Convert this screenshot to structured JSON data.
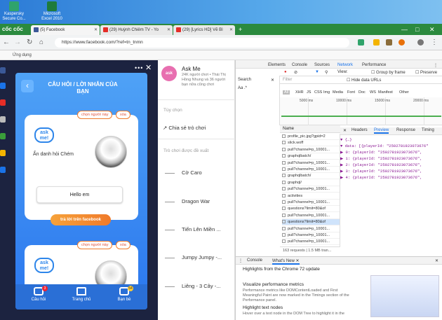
{
  "desktop": {
    "icons": [
      {
        "label": "Kaspersky Secure Co...",
        "color": "#2fa36b"
      },
      {
        "label": "Microsoft Excel 2010",
        "color": "#1e7b3b"
      }
    ]
  },
  "browser": {
    "logo": "cốc cốc",
    "tabs": [
      {
        "label": "(5) Facebook",
        "color": "#3b5998"
      },
      {
        "label": "(29) Huỳnh Chiêm TV - Yo",
        "color": "#e52d27"
      },
      {
        "label": "(29) [Lyrics HD] Vẽ Bì",
        "color": "#e52d27"
      }
    ],
    "new_tab": "+",
    "url": "https://www.facebook.com/?ref=tn_tnmn",
    "bookmarks_label": "Ứng dụng",
    "winbtns": [
      "—",
      "□",
      "✕"
    ]
  },
  "game": {
    "title": "CÂU HỎI / LỜI NHẮN CỦA BẠN",
    "back": "‹",
    "close": "✕",
    "dots": "•••",
    "cards": [
      {
        "chon": "chọn người này",
        "xoa": "xóa",
        "ask": "ask me!",
        "anon": "Ẩn danh hỏi Chém",
        "message": "Hello em",
        "reply": "trả lời trên facebook"
      },
      {
        "chon": "chọn người này",
        "xoa": "xóa",
        "ask": "ask me!"
      }
    ],
    "footer": [
      {
        "label": "Câu hỏi",
        "badge": "3"
      },
      {
        "label": "Trang chủ",
        "badge": ""
      },
      {
        "label": "Bạn bè",
        "badge": "54"
      }
    ]
  },
  "fbside": {
    "app_name": "Ask Me",
    "app_logo": "ask me!",
    "app_desc": "24K người chơi • Thái Thị Hồng Nhung và 36 người bạn nữa cũng chơi",
    "section_options": "Tùy chọn",
    "share": "Chia sẻ trò chơi",
    "section_suggested": "Trò chơi được đề xuất",
    "games": [
      "Cờ Caro",
      "Dragon War",
      "Tiến Lên Miền ...",
      "Jumpy Jumpy -...",
      "Liêng - 3 Cây -..."
    ]
  },
  "devtools": {
    "tabs": [
      "Elements",
      "Console",
      "Sources",
      "Network",
      "Performance"
    ],
    "search_label": "Search",
    "filter_label": "Filter",
    "view_label": "View:",
    "group_by_frame": "Group by frame",
    "preserve": "Preserve",
    "hide_data": "Hide data URLs",
    "types": [
      "All",
      "XHR",
      "JS",
      "CSS",
      "Img",
      "Media",
      "Font",
      "Doc",
      "WS",
      "Manifest",
      "Other"
    ],
    "ticks": [
      "5000 ms",
      "10000 ms",
      "15000 ms",
      "20000 ms"
    ],
    "name_header": "Name",
    "requests": [
      "profile_pic.jpg?gpid=2",
      "slick.woff",
      "pull?channel=p_10001...",
      "graphqlbatch/",
      "pull?channel=p_10001...",
      "pull?channel=p_10001...",
      "graphqlbatch/",
      "graphql/",
      "pull?channel=p_10001...",
      "activities",
      "pull?channel=p_10001...",
      "questions?limit=80&of",
      "pull?channel=p_10001...",
      "questions?limit=80&of",
      "pull?channel=p_10001...",
      "pull?channel=p_10001...",
      "pull?channel=p_10001..."
    ],
    "selected_index": 13,
    "status": "163 requests | 1.5 MB tran...",
    "preview_tabs": [
      "Headers",
      "Preview",
      "Response",
      "Timing"
    ],
    "preview": [
      {
        "t": "▼ {…}"
      },
      {
        "t": "  ▼ data: [{playerId: \"2502781923073676\""
      },
      {
        "t": "    ▶ 0: {playerId: \"2502781923073676\","
      },
      {
        "t": "    ▶ 1: {playerId: \"2502781923073676\","
      },
      {
        "t": "    ▶ 2: {playerId: \"2502781923073676\","
      },
      {
        "t": "    ▶ 3: {playerId: \"2502781923073676\","
      },
      {
        "t": "    ▶ 4: {playerId: \"2502781923073676\","
      }
    ],
    "console_tabs": [
      "Console",
      "What's New ✕"
    ],
    "highlights": "Highlights from the Chrome 72 update",
    "h1": "Visualize performance metrics",
    "h1_desc": "Performance metrics like DOMContentLoaded and First Meaningful Paint are now marked in the Timings section of the Performance panel.",
    "h2": "Highlight text nodes",
    "h2_desc": "Hover over a text node in the DOM Tree to highlight it in the"
  }
}
